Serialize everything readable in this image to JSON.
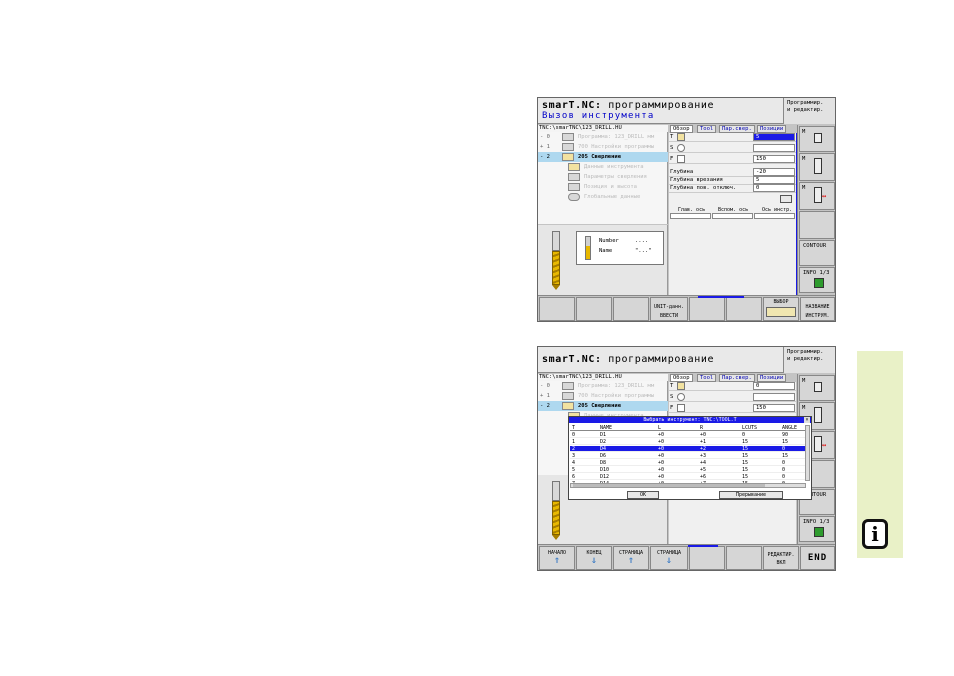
{
  "screen1": {
    "title": {
      "app": "smarT.NC:",
      "mode": "программирование",
      "subtitle": "Вызов инструмента"
    },
    "mode_box": {
      "line1": "Программир.",
      "line2": "и редактир."
    },
    "path": "TNC:\\smarTNC\\123_DRILL.HU",
    "tree": [
      {
        "expander": "- 0",
        "label": "Программа: 123_DRILL мм"
      },
      {
        "expander": "+ 1",
        "label": "700 Настройки программы"
      },
      {
        "expander": "- 2",
        "label": "205 Сверление"
      },
      {
        "expander": "",
        "label": "Данные инструмента"
      },
      {
        "expander": "",
        "label": "Параметры сверления"
      },
      {
        "expander": "",
        "label": "Позиция и высота"
      },
      {
        "expander": "",
        "label": "Глобальные данные"
      }
    ],
    "info": {
      "number_label": "Number",
      "number_value": "....",
      "name_label": "Name",
      "name_value": "\"...\""
    },
    "tabs": [
      "Обзор",
      "Tool",
      "Пар.свер.",
      "Позиции"
    ],
    "fields": {
      "T": {
        "value": "5"
      },
      "S": {
        "value": ""
      },
      "F": {
        "value": "150"
      },
      "depth": {
        "label": "Глубина",
        "value": "-20"
      },
      "infeed": {
        "label": "Глубина врезания",
        "value": "5"
      },
      "dwell": {
        "label": "Глубина пов. отключ.",
        "value": "0"
      }
    },
    "axis_cols": [
      "Глав. ось",
      "Вспом. ось",
      "Ось инстр."
    ],
    "side_softkeys": [
      {
        "label": "M"
      },
      {
        "label": "M"
      },
      {
        "label": "M"
      },
      {
        "label": ""
      },
      {
        "label": "CONTOUR"
      },
      {
        "label": "INFO 1/3"
      }
    ],
    "bottom_softkeys": [
      {
        "line1": "",
        "line2": ""
      },
      {
        "line1": "",
        "line2": ""
      },
      {
        "line1": "",
        "line2": ""
      },
      {
        "line1": "UNIT-данн.",
        "line2": "ВВЕСТИ"
      },
      {
        "line1": "",
        "line2": ""
      },
      {
        "line1": "",
        "line2": ""
      },
      {
        "line1": "ВЫБОР",
        "line2": ""
      },
      {
        "line1": "НАЗВАНИЕ",
        "line2": "ИНСТРУМ."
      }
    ]
  },
  "screen2": {
    "title": {
      "app": "smarT.NC:",
      "mode": "программирование"
    },
    "mode_box": {
      "line1": "Программир.",
      "line2": "и редактир."
    },
    "path": "TNC:\\smarTNC\\123_DRILL.HU",
    "tree": [
      {
        "expander": "- 0",
        "label": "Программа: 123_DRILL мм"
      },
      {
        "expander": "+ 1",
        "label": "700 Настройки программы"
      },
      {
        "expander": "- 2",
        "label": "205 Сверление"
      },
      {
        "expander": "",
        "label": "Данные инструмента"
      }
    ],
    "tabs": [
      "Обзор",
      "Tool",
      "Пар.свер.",
      "Позиции"
    ],
    "fields": {
      "T": {
        "value": "0"
      },
      "S": {
        "value": ""
      },
      "F": {
        "value": "150"
      }
    },
    "popup": {
      "title": "Выбрать инструмент: TNC:\\TOOL.T",
      "columns": [
        "T",
        "NAME",
        "L",
        "R",
        "LCUTS",
        "ANGLE"
      ],
      "rows": [
        [
          "0",
          "D1",
          "+0",
          "+0",
          "0",
          "90"
        ],
        [
          "1",
          "D2",
          "+0",
          "+1",
          "15",
          "15"
        ],
        [
          "2",
          "D4",
          "+0",
          "+2",
          "15",
          "0"
        ],
        [
          "3",
          "D6",
          "+0",
          "+3",
          "15",
          "15"
        ],
        [
          "4",
          "D8",
          "+0",
          "+4",
          "15",
          "0"
        ],
        [
          "5",
          "D10",
          "+0",
          "+5",
          "15",
          "0"
        ],
        [
          "6",
          "D12",
          "+0",
          "+6",
          "15",
          "0"
        ],
        [
          "7",
          "D14",
          "+0",
          "+7",
          "15",
          "0"
        ]
      ],
      "highlight_index": 2,
      "ok": "OK",
      "cancel": "Прерывание"
    },
    "side_softkeys": [
      {
        "label": "M"
      },
      {
        "label": "M"
      },
      {
        "label": "M"
      },
      {
        "label": ""
      },
      {
        "label": "CONTOUR"
      },
      {
        "label": "INFO 1/3"
      }
    ],
    "bottom_softkeys": [
      {
        "line1": "НАЧАЛО",
        "line2": ""
      },
      {
        "line1": "КОНЕЦ",
        "line2": ""
      },
      {
        "line1": "СТРАНИЦА",
        "line2": ""
      },
      {
        "line1": "СТРАНИЦА",
        "line2": ""
      },
      {
        "line1": "",
        "line2": ""
      },
      {
        "line1": "",
        "line2": ""
      },
      {
        "line1": "РЕДАКТИР.",
        "line2": "ВКЛ"
      },
      {
        "line1": "END",
        "line2": ""
      }
    ]
  },
  "info_icon": "info-icon",
  "colors": {
    "accent": "#1a1ae6",
    "selection": "#aed8ef",
    "info_strip": "#e9f1c7",
    "tool_yellow": "#e8b800"
  }
}
